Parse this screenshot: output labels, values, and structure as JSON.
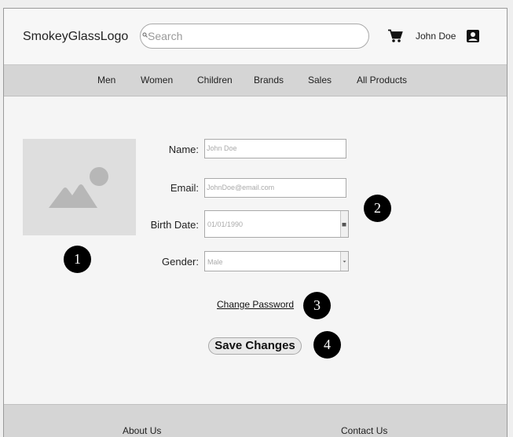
{
  "header": {
    "logo": "SmokeyGlassLogo",
    "search_placeholder": "Search",
    "username": "John Doe",
    "cart_icon": "cart-icon",
    "account_icon": "account-box-icon"
  },
  "nav": {
    "items": [
      "Men",
      "Women",
      "Children",
      "Brands",
      "Sales",
      "All Products"
    ]
  },
  "profile": {
    "photo_icon": "image-placeholder-icon",
    "name_label": "Name:",
    "name_placeholder": "John Doe",
    "email_label": "Email:",
    "email_placeholder": "JohnDoe@email.com",
    "birth_label": "Birth Date:",
    "birth_value": "01/01/1990",
    "gender_label": "Gender:",
    "gender_value": "Male",
    "change_password": "Change Password",
    "save_button": "Save Changes"
  },
  "markers": [
    "1",
    "2",
    "3",
    "4"
  ],
  "footer": {
    "about": "About Us",
    "contact": "Contact Us"
  },
  "colors": {
    "page_bg": "#f5f5f5",
    "nav_bg": "#d5d5d5",
    "marker": "#000000"
  }
}
